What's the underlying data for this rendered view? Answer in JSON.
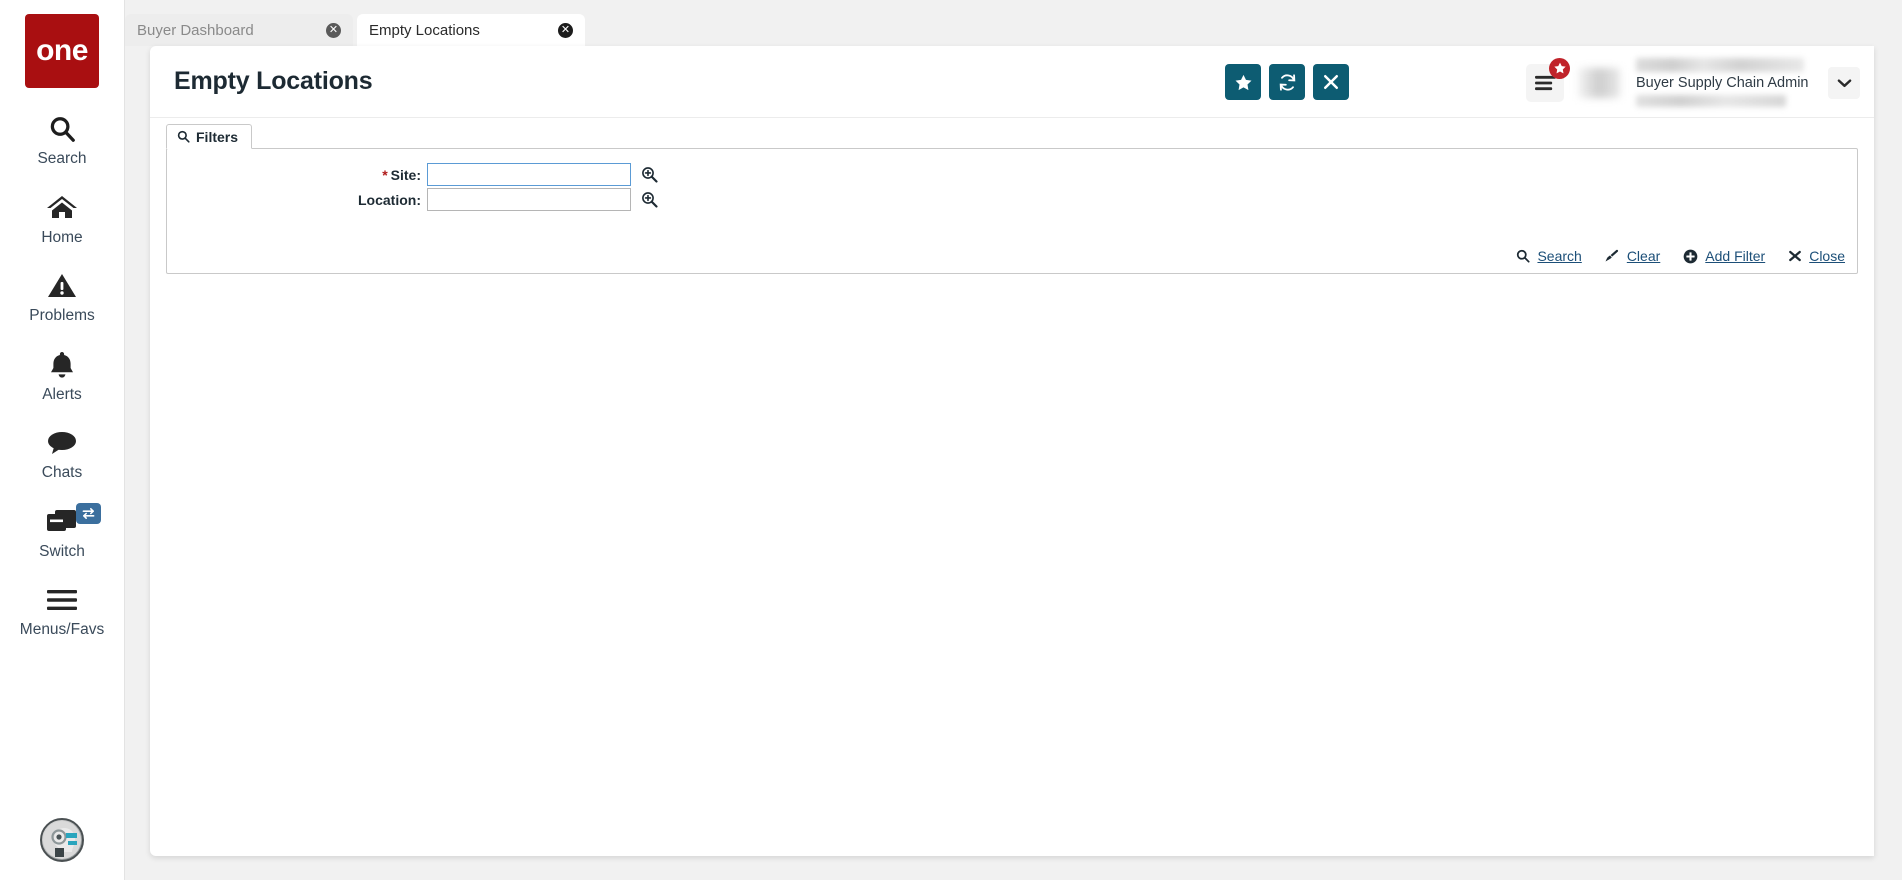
{
  "sidebar": {
    "logo_text": "one",
    "items": [
      {
        "label": "Search",
        "icon": "search-icon"
      },
      {
        "label": "Home",
        "icon": "home-icon"
      },
      {
        "label": "Problems",
        "icon": "warning-triangle-icon"
      },
      {
        "label": "Alerts",
        "icon": "bell-icon"
      },
      {
        "label": "Chats",
        "icon": "chat-bubble-icon"
      },
      {
        "label": "Switch",
        "icon": "windows-stack-icon",
        "badge_icon": "swap-arrows-icon"
      },
      {
        "label": "Menus/Favs",
        "icon": "hamburger-icon"
      }
    ],
    "avatar_icon": "assistant-avatar-icon"
  },
  "tabs": [
    {
      "label": "Buyer Dashboard",
      "active": false,
      "close_icon": "close-circle-icon"
    },
    {
      "label": "Empty Locations",
      "active": true,
      "close_icon": "close-circle-icon"
    }
  ],
  "header": {
    "title": "Empty Locations",
    "buttons": [
      {
        "name": "favorite-button",
        "icon": "star-icon"
      },
      {
        "name": "refresh-button",
        "icon": "refresh-icon"
      },
      {
        "name": "close-button",
        "icon": "x-icon"
      }
    ],
    "menu_favs": {
      "icon": "hamburger-icon",
      "badge_icon": "star-icon"
    },
    "user": {
      "name": "",
      "role": "Buyer Supply Chain Admin",
      "org": "",
      "caret_icon": "chevron-down-icon"
    }
  },
  "filters": {
    "tab_label": "Filters",
    "tab_icon": "search-icon",
    "fields": [
      {
        "label": "Site:",
        "required": true,
        "value": "",
        "placeholder": "",
        "focused": true,
        "lookup_icon": "magnifier-plus-icon"
      },
      {
        "label": "Location:",
        "required": false,
        "value": "",
        "placeholder": "",
        "focused": false,
        "lookup_icon": "magnifier-plus-icon"
      }
    ],
    "actions": [
      {
        "label": "Search",
        "icon": "search-icon"
      },
      {
        "label": "Clear",
        "icon": "brush-icon"
      },
      {
        "label": "Add Filter",
        "icon": "plus-circle-icon"
      },
      {
        "label": "Close",
        "icon": "x-icon"
      }
    ]
  },
  "colors": {
    "brand_red": "#a90f11",
    "accent_teal": "#0d5c72",
    "link_blue": "#1c4f78",
    "badge_red": "#c0232a",
    "focus_blue": "#5b9bd5",
    "required_red": "#b01b1b",
    "page_bg": "#f1f1f1"
  }
}
